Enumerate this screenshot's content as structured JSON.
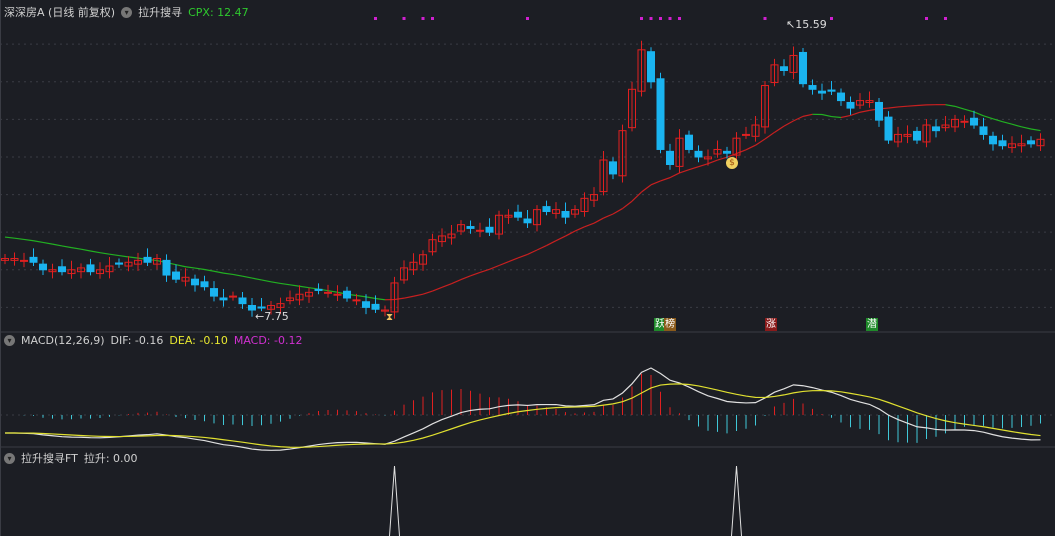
{
  "header": {
    "title": "深深房A (日线 前复权)",
    "indicator": "拉升搜寻",
    "cpx_label": "CPX:",
    "cpx_value": "12.47"
  },
  "main_chart": {
    "high_label": "15.59",
    "low_label": "7.75"
  },
  "macd_panel": {
    "title": "MACD(12,26,9)",
    "dif": "DIF: -0.16",
    "dea": "DEA: -0.10",
    "macd": "MACD: -0.12"
  },
  "ft_panel": {
    "title": "拉升搜寻FT",
    "value": "拉升: 0.00"
  },
  "signals": [
    {
      "text": "跃",
      "color": "#1f8a2a"
    },
    {
      "text": "榜",
      "color": "#8a5a1a"
    },
    {
      "text": "涨",
      "color": "#8a1a1a"
    },
    {
      "text": "潜",
      "color": "#1f8a2a"
    }
  ],
  "icons": {
    "hourglass": "hourglass-icon",
    "money_bag": "money-bag-icon"
  },
  "colors": {
    "up": "#e02020",
    "down": "#1ab4f0",
    "ma_up": "#c82020",
    "ma_down": "#22b022",
    "dif": "#e0e0e0",
    "dea": "#e0e030",
    "dot": "#d020d0"
  },
  "chart_data": {
    "type": "candlestick",
    "price_range": [
      7.75,
      15.59
    ],
    "close": [
      9.3,
      9.3,
      9.25,
      9.2,
      9.0,
      9.0,
      8.95,
      9.0,
      9.05,
      8.95,
      9.0,
      9.1,
      9.15,
      9.2,
      9.25,
      9.2,
      9.3,
      8.86,
      8.75,
      8.8,
      8.6,
      8.55,
      8.3,
      8.2,
      8.3,
      8.1,
      7.93,
      8.0,
      8.05,
      8.1,
      8.25,
      8.35,
      8.4,
      8.45,
      8.4,
      8.35,
      8.25,
      8.2,
      8.0,
      7.95,
      7.93,
      8.65,
      9.05,
      9.2,
      9.4,
      9.8,
      9.9,
      9.95,
      10.2,
      10.1,
      10.05,
      10.0,
      10.45,
      10.45,
      10.4,
      10.25,
      10.6,
      10.55,
      10.6,
      10.4,
      10.6,
      10.9,
      11.0,
      11.92,
      11.55,
      12.7,
      13.8,
      14.85,
      14.0,
      12.2,
      11.8,
      12.5,
      12.2,
      12.0,
      12.0,
      12.2,
      12.1,
      12.5,
      12.6,
      12.85,
      13.9,
      14.45,
      14.3,
      14.7,
      13.95,
      13.8,
      13.7,
      13.75,
      13.5,
      13.3,
      13.5,
      13.5,
      12.98,
      12.45,
      12.6,
      12.6,
      12.45,
      12.85,
      12.7,
      12.85,
      13.0,
      12.95,
      12.85,
      12.6,
      12.35,
      12.3,
      12.35,
      12.35,
      12.35,
      12.47
    ],
    "signal_dots": [
      39,
      42,
      44,
      45,
      55,
      67,
      68,
      69,
      70,
      71,
      80,
      87,
      97,
      99
    ],
    "ft_spikes": [
      41,
      77
    ],
    "ma_period": 20
  }
}
